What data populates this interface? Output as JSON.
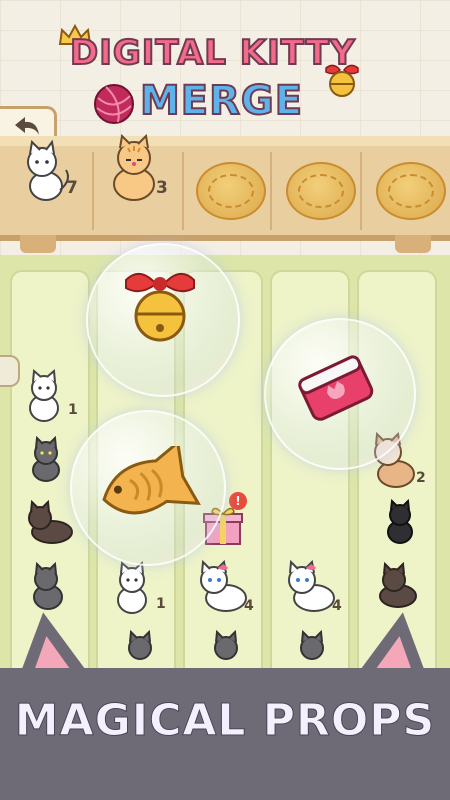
{
  "game": {
    "title_line1": "DIGITAL KITTY",
    "title_line2": "MERGE",
    "footer_caption": "MAGICAL PROPS"
  },
  "shelf": {
    "slots": [
      {
        "cat": "white-kitten",
        "count": "7"
      },
      {
        "cat": "orange-kitten",
        "count": "3"
      },
      {
        "cat": "empty-cushion",
        "count": ""
      },
      {
        "cat": "empty-cushion",
        "count": ""
      },
      {
        "cat": "empty-cushion",
        "count": ""
      }
    ]
  },
  "board": {
    "labels": {
      "white_cat_count_1": "1",
      "orange_cat_count": "2",
      "white_cat_count_2": "1",
      "marie_cat_count_1": "4",
      "marie_cat_count_2": "4"
    },
    "props": [
      "bell-icon",
      "eraser-icon",
      "taiyaki-icon",
      "gift-icon"
    ],
    "alert_mark": "!"
  },
  "colors": {
    "title_pink": "#f46a8a",
    "title_blue": "#5fb3ea",
    "footer_gray": "#6e6b76",
    "board_green": "#dde6a8"
  }
}
